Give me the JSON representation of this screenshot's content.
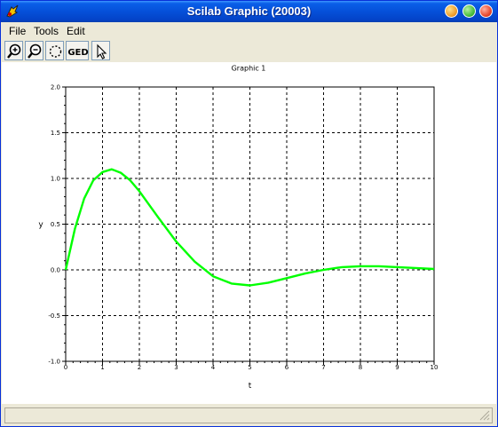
{
  "window": {
    "title": "Scilab Graphic (20003)"
  },
  "menu": {
    "file": "File",
    "tools": "Tools",
    "edit": "Edit"
  },
  "toolbar": {
    "ged_label": "GED"
  },
  "chart_data": {
    "type": "line",
    "title": "Graphic 1",
    "xlabel": "t",
    "ylabel": "y",
    "xlim": [
      0,
      10
    ],
    "ylim": [
      -1.0,
      2.0
    ],
    "grid": true,
    "x_ticks": [
      "0",
      "1",
      "2",
      "3",
      "4",
      "5",
      "6",
      "7",
      "8",
      "9",
      "10"
    ],
    "y_ticks": [
      "-1.0",
      "-0.5",
      "0.0",
      "0.5",
      "1.0",
      "1.5",
      "2.0"
    ],
    "series": [
      {
        "color": "#00ff00",
        "x": [
          0,
          0.25,
          0.5,
          0.75,
          1.0,
          1.25,
          1.5,
          1.75,
          2.0,
          2.5,
          3.0,
          3.5,
          4.0,
          4.5,
          5.0,
          5.5,
          6.0,
          6.5,
          7.0,
          7.5,
          8.0,
          8.5,
          9.0,
          9.5,
          10.0
        ],
        "y": [
          0,
          0.45,
          0.78,
          0.98,
          1.07,
          1.1,
          1.06,
          0.98,
          0.86,
          0.58,
          0.31,
          0.09,
          -0.07,
          -0.15,
          -0.17,
          -0.14,
          -0.09,
          -0.04,
          0.0,
          0.03,
          0.04,
          0.04,
          0.03,
          0.02,
          0.01
        ]
      }
    ]
  }
}
